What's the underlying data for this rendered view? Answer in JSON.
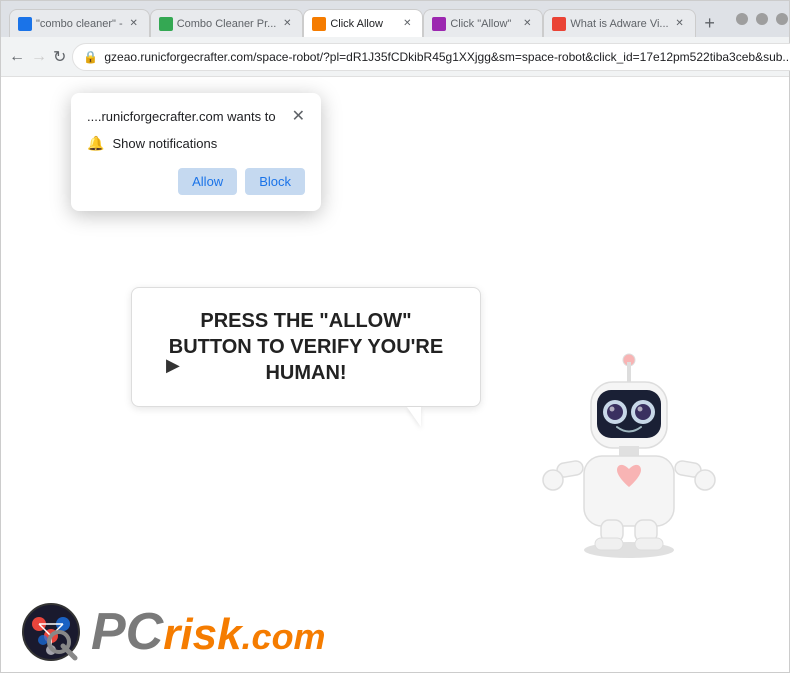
{
  "browser": {
    "tabs": [
      {
        "id": "tab1",
        "label": "\"combo cleaner\" -",
        "active": false,
        "favicon_color": "#1a73e8"
      },
      {
        "id": "tab2",
        "label": "Combo Cleaner Pr...",
        "active": false,
        "favicon_color": "#34a853"
      },
      {
        "id": "tab3",
        "label": "Click Allow",
        "active": true,
        "favicon_color": "#f57c00"
      },
      {
        "id": "tab4",
        "label": "Click \"Allow\"",
        "active": false,
        "favicon_color": "#9c27b0"
      },
      {
        "id": "tab5",
        "label": "What is Adware Vi...",
        "active": false,
        "favicon_color": "#ea4335"
      }
    ],
    "new_tab_label": "+",
    "address": "gzeao.runicforgecrafter.com/space-robot/?pl=dR1J35fCDkibR45g1XXjgg&sm=space-robot&click_id=17e12pm522tiba3ceb&sub...",
    "back_disabled": false,
    "forward_disabled": false,
    "window_controls": {
      "minimize": "–",
      "maximize": "□",
      "close": "✕"
    }
  },
  "notification_popup": {
    "site_text": "....runicforgecrafter.com wants to",
    "notification_label": "Show notifications",
    "allow_label": "Allow",
    "block_label": "Block",
    "close_label": "✕"
  },
  "speech_bubble": {
    "text": "PRESS THE \"ALLOW\" BUTTON TO VERIFY YOU'RE HUMAN!"
  },
  "pcrisk": {
    "pc_label": "PC",
    "risk_label": "risk",
    "dotcom_label": ".com"
  }
}
